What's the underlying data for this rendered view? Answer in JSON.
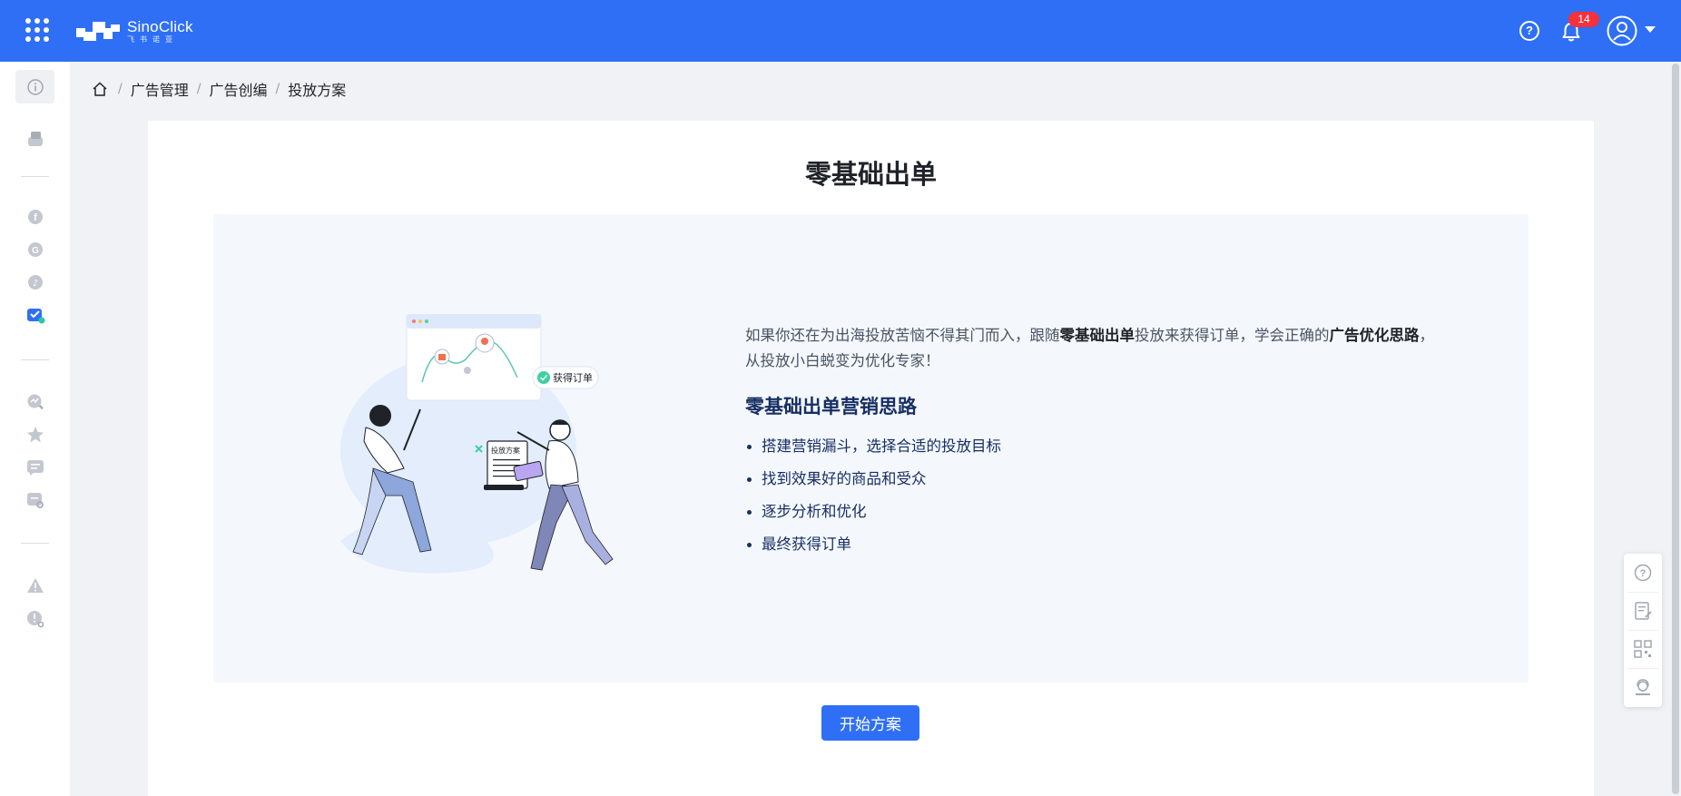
{
  "header": {
    "logo_text": "SinoClick",
    "logo_subtext": "飞书诺亚",
    "notification_count": "14",
    "brand_color": "#2e6ff5",
    "icons": [
      "apps-grid-icon",
      "question-circle-icon",
      "bell-icon",
      "user-avatar-icon",
      "caret-down-icon"
    ]
  },
  "sidebar": {
    "items": [
      {
        "icon": "info-circle-icon",
        "active": true
      },
      {
        "icon": "cards-icon"
      },
      {
        "icon": "facebook-icon"
      },
      {
        "icon": "google-icon"
      },
      {
        "icon": "tiktok-icon"
      },
      {
        "icon": "megaphone-icon",
        "active_color": "#2e6ff5"
      },
      {
        "icon": "chart-search-icon"
      },
      {
        "icon": "star-icon"
      },
      {
        "icon": "message-list-icon"
      },
      {
        "icon": "chat-search-icon"
      },
      {
        "icon": "warning-icon"
      },
      {
        "icon": "alert-search-icon"
      }
    ]
  },
  "breadcrumb": {
    "home_icon": "home-icon",
    "items": [
      "广告管理",
      "广告创编",
      "投放方案"
    ]
  },
  "main": {
    "title": "零基础出单",
    "illustration": {
      "badge_label": "获得订单",
      "doc_label": "投放方案"
    },
    "intro": {
      "p1": "如果你还在为出海投放苦恼不得其门而入，跟随",
      "b1": "零基础出单",
      "p2": "投放来获得订单，学会正确的",
      "b2": "广告优化思路",
      "p3": "，从投放小白蜕变为优化专家！"
    },
    "section_title": "零基础出单营销思路",
    "bullets": [
      "搭建营销漏斗，选择合适的投放目标",
      "找到效果好的商品和受众",
      "逐步分析和优化",
      "最终获得订单"
    ],
    "start_button": "开始方案"
  },
  "float_tools": [
    "question-circle-icon",
    "feedback-edit-icon",
    "qr-code-icon",
    "customer-service-icon"
  ]
}
